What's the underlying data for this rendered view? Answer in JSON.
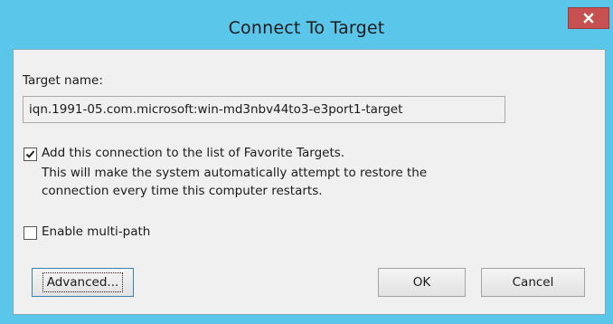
{
  "window": {
    "title": "Connect To Target",
    "close_glyph": "x"
  },
  "target": {
    "label": "Target name:",
    "value": "iqn.1991-05.com.microsoft:win-md3nbv44to3-e3port1-target"
  },
  "favorites": {
    "checked": true,
    "label": "Add this connection to the list of Favorite Targets.",
    "description_line1": "This will make the system automatically attempt to restore the",
    "description_line2": "connection every time this computer restarts."
  },
  "multipath": {
    "checked": false,
    "label": "Enable multi-path"
  },
  "buttons": {
    "advanced": "Advanced...",
    "ok": "OK",
    "cancel": "Cancel"
  },
  "colors": {
    "titlebar": "#5ac6ea",
    "close_button": "#c75050",
    "dialog_background": "#f0f0f0"
  }
}
